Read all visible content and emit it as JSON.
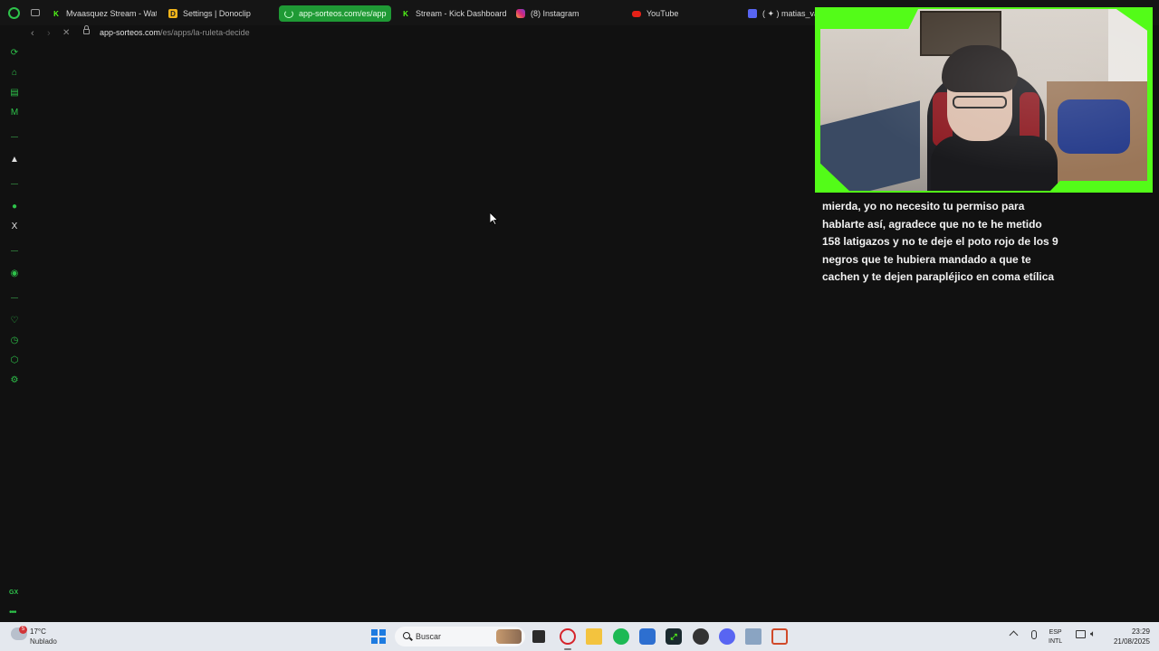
{
  "browser": {
    "tabs": [
      {
        "label": "Mvaasquez Stream - Wat",
        "favicon": "kick-icon"
      },
      {
        "label": "Settings | Donoclip",
        "favicon": "donoclip-icon"
      },
      {
        "label": "app-sorteos.com/es/app",
        "favicon": "loading-icon",
        "active": true
      },
      {
        "label": "Stream - Kick Dashboard",
        "favicon": "kick-icon"
      },
      {
        "label": "(8) Instagram",
        "favicon": "instagram-icon"
      },
      {
        "label": "YouTube",
        "favicon": "youtube-icon"
      },
      {
        "label": "( ✦ ) matias_vas",
        "favicon": "discord-icon"
      }
    ],
    "address": {
      "host": "app-sorteos.com",
      "path": "/es/apps/la-ruleta-decide"
    },
    "sidebar": {
      "icons": [
        "refresh-icon",
        "flow-icon",
        "twitch-icon",
        "mail-icon",
        "artstation-icon",
        "whatsapp-icon",
        "x-icon",
        "player-icon",
        "heart-icon",
        "history-icon",
        "extensions-icon",
        "settings-icon"
      ],
      "gx_label": "GX",
      "more_label": "•••"
    },
    "accent_color": "#53fc18"
  },
  "stream_overlay": {
    "chat_message": "mierda, yo no necesito tu permiso para hablarte así, agradece que no te he metido 158 latigazos y no te deje el poto rojo de los 9 negros que te hubiera mandado a que te cachen y te dejen parapléjico en coma etílica"
  },
  "taskbar": {
    "weather": {
      "temp": "17°C",
      "condition": "Nublado",
      "badge": "5"
    },
    "search_label": "Buscar",
    "apps": [
      "windows-icon",
      "terminal-icon",
      "opera-gx-icon",
      "files-icon",
      "spotify-icon",
      "store-icon",
      "kick-studio-icon",
      "obs-icon",
      "discord-icon",
      "calculator-icon",
      "snipping-icon"
    ],
    "language": {
      "line1": "ESP",
      "line2": "INTL"
    },
    "time": "23:29",
    "date": "21/08/2025"
  }
}
